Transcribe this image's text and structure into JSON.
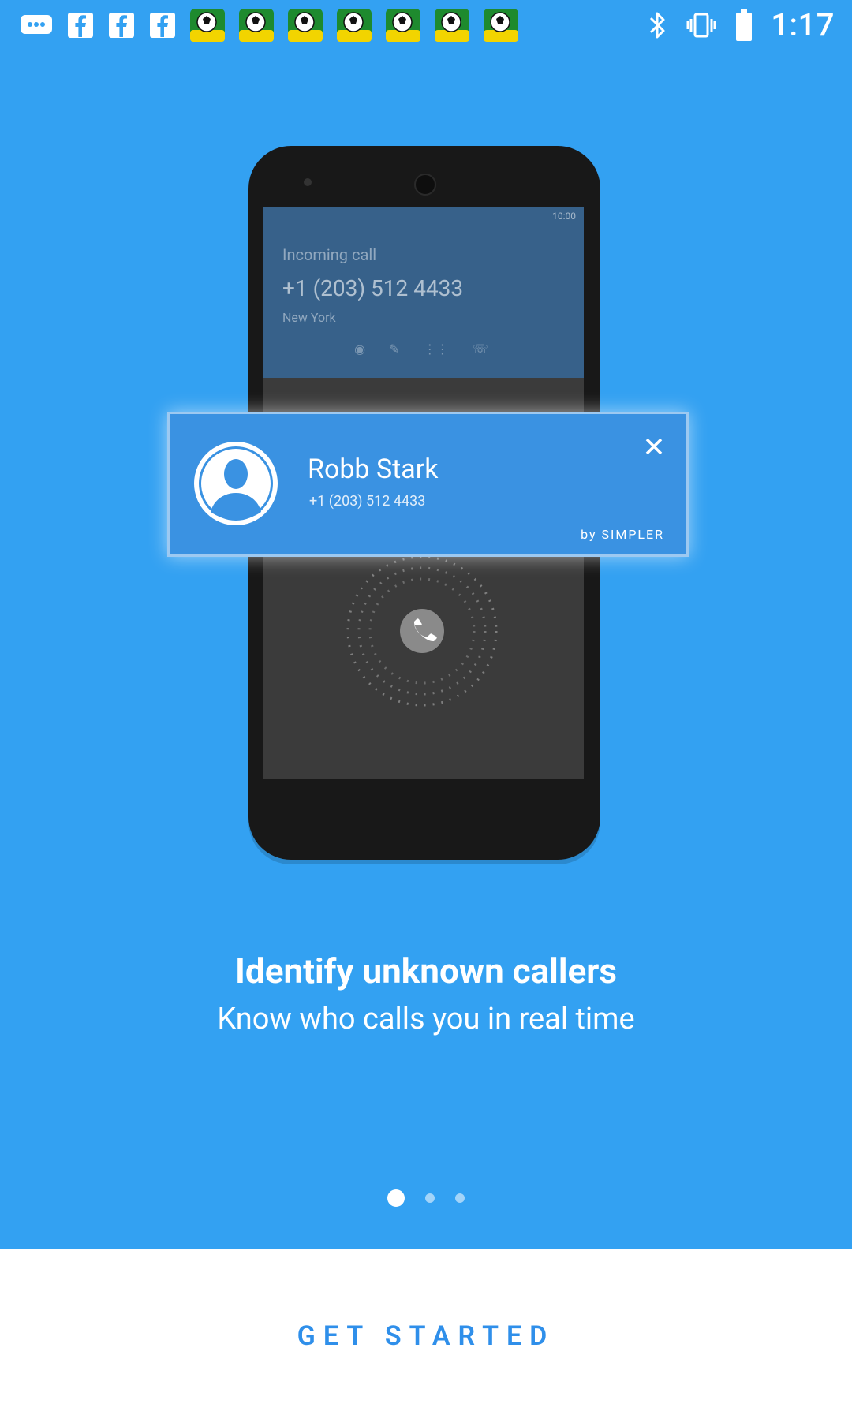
{
  "status_bar": {
    "time": "1:17",
    "left_icons": [
      "messages-icon",
      "facebook-icon",
      "facebook-icon",
      "facebook-icon",
      "soccer-icon",
      "soccer-icon",
      "soccer-icon",
      "soccer-icon",
      "soccer-icon",
      "soccer-icon",
      "soccer-icon"
    ],
    "right_icons": [
      "bluetooth-icon",
      "vibrate-icon",
      "battery-icon"
    ]
  },
  "illustration": {
    "incoming_screen": {
      "clock": "10:00",
      "label": "Incoming call",
      "number": "+1 (203) 512 4433",
      "location": "New York"
    },
    "caller_card": {
      "name": "Robb Stark",
      "number": "+1 (203) 512 4433",
      "brand": "by SIMPLER"
    }
  },
  "onboarding": {
    "title": "Identify unknown callers",
    "subtitle": "Know who calls you in real time",
    "pages_total": 3,
    "page_current": 1
  },
  "footer": {
    "cta_label": "GET STARTED"
  },
  "colors": {
    "background": "#33a1f2",
    "card": "#3a92e2",
    "cta": "#2f8fea"
  }
}
